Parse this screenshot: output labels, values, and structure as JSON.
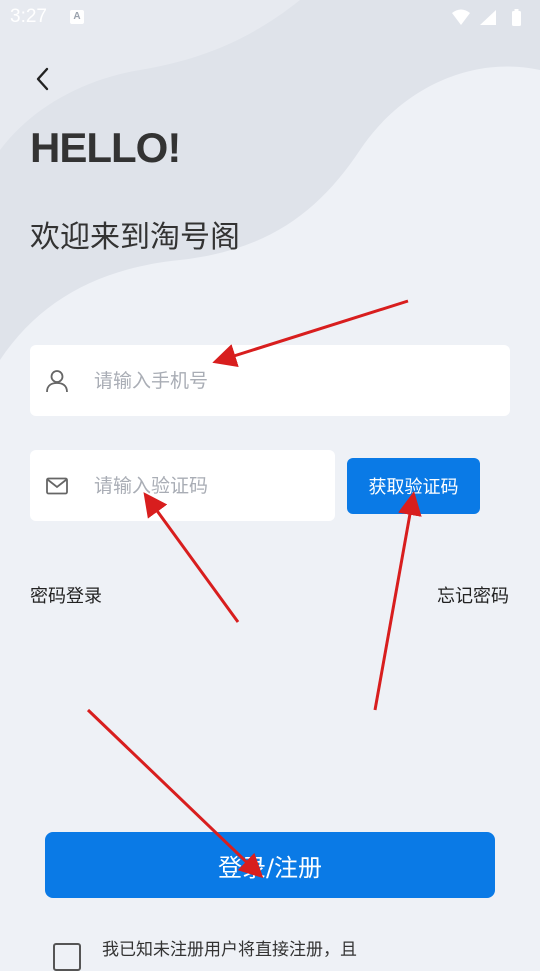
{
  "status_bar": {
    "time": "3:27",
    "notification_badge": "A",
    "icons": [
      "wifi-icon",
      "signal-icon",
      "battery-icon"
    ]
  },
  "header": {
    "back_icon": "chevron-left-icon",
    "hello": "HELLO!",
    "welcome": "欢迎来到淘号阁"
  },
  "form": {
    "phone": {
      "placeholder": "请输入手机号",
      "value": "",
      "icon": "user-icon"
    },
    "code": {
      "placeholder": "请输入验证码",
      "value": "",
      "icon": "mail-icon"
    },
    "get_code_label": "获取验证码"
  },
  "links": {
    "password_login": "密码登录",
    "forgot_password": "忘记密码"
  },
  "login_button_label": "登录/注册",
  "agreement": {
    "checked": false,
    "text": "我已知未注册用户将直接注册，且"
  },
  "colors": {
    "accent": "#0a7ae6",
    "background": "#eef1f6",
    "annotation_arrow": "#d81e1e"
  }
}
